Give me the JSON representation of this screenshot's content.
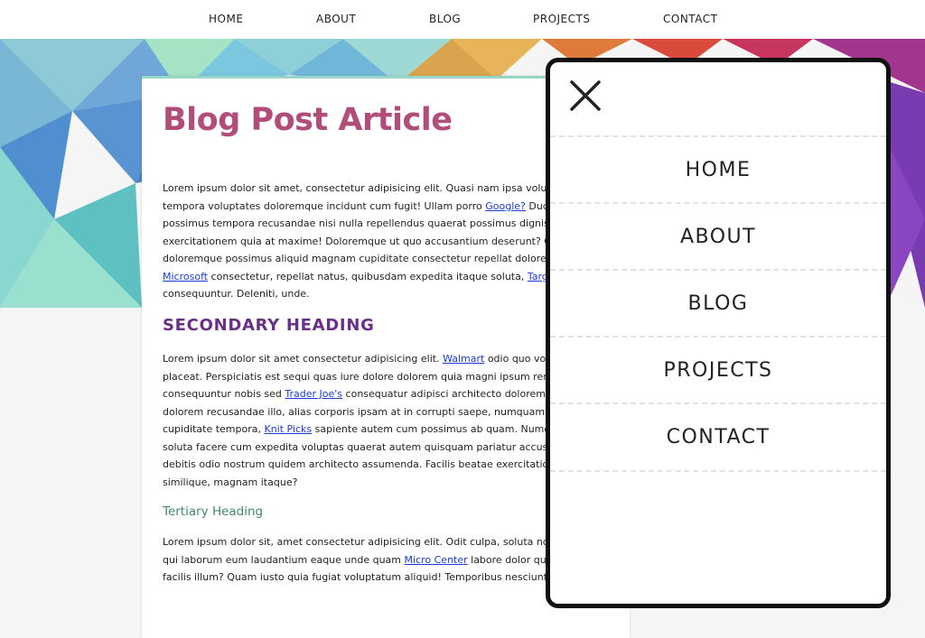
{
  "topnav": {
    "items": [
      {
        "label": "HOME"
      },
      {
        "label": "ABOUT"
      },
      {
        "label": "BLOG"
      },
      {
        "label": "PROJECTS"
      },
      {
        "label": "CONTACT"
      }
    ]
  },
  "article": {
    "title": "Blog Post Article",
    "p1": {
      "a": "Lorem ipsum dolor sit amet, consectetur adipisicing elit. Quasi nam ipsa voluptatum tempora voluptates doloremque incidunt cum fugit! Ullam porro ",
      "link1": "Google?",
      "b": " Ducimus incidunt possimus tempora recusandae nisi nulla repellendus quaerat possimus dignissimos exercitationem quia at maxime! Doloremque ut quo accusantium deserunt? Officiis labore doloremque possimus aliquid magnam cupiditate consectetur repellat dolore, atque, ",
      "link2": "Microsoft",
      "c": " consectetur, repellat natus, quibusdam expedita itaque soluta, ",
      "link3": "Target",
      "d": " consequuntur. Deleniti, unde."
    },
    "secondary_heading": "SECONDARY HEADING",
    "p2": {
      "a": "Lorem ipsum dolor sit amet consectetur adipisicing elit. ",
      "link1": "Walmart",
      "b": " odio quo voluptatem placeat. Perspiciatis est sequi quas iure dolore dolorem quia magni ipsum rem unde consequuntur nobis sed ",
      "link2": "Trader Joe's",
      "c": " consequatur adipisci architecto doloremque odio ut dolorem recusandae illo, alias corporis ipsam at in corrupti saepe, numquam animi dolor cupiditate tempora, ",
      "link3": "Knit Picks",
      "d": " sapiente autem cum possimus ab quam. Numquam rem soluta facere cum expedita voluptas quaerat autem quisquam pariatur accusantium nisi debitis odio nostrum quidem architecto assumenda. Facilis beatae exercitationem earum similique, magnam itaque?"
    },
    "tertiary_heading": "Tertiary Heading",
    "p3": {
      "a": "Lorem ipsum dolor sit, amet consectetur adipisicing elit. Odit culpa, soluta non provident qui laborum eum laudantium eaque unde quam ",
      "link1": "Micro Center",
      "b": " labore dolor quaerat quas, facilis illum? Quam iusto quia fugiat voluptatum aliquid! Temporibus nesciunt"
    }
  },
  "overlay_menu": {
    "close_icon": "close-x-icon",
    "items": [
      {
        "label": "HOME"
      },
      {
        "label": "ABOUT"
      },
      {
        "label": "BLOG"
      },
      {
        "label": "PROJECTS"
      },
      {
        "label": "CONTACT"
      }
    ]
  },
  "colors": {
    "title": "#b24d7b",
    "secondary_heading": "#6a2f86",
    "tertiary_heading": "#3f8a6b",
    "link": "#1a3bd6"
  }
}
